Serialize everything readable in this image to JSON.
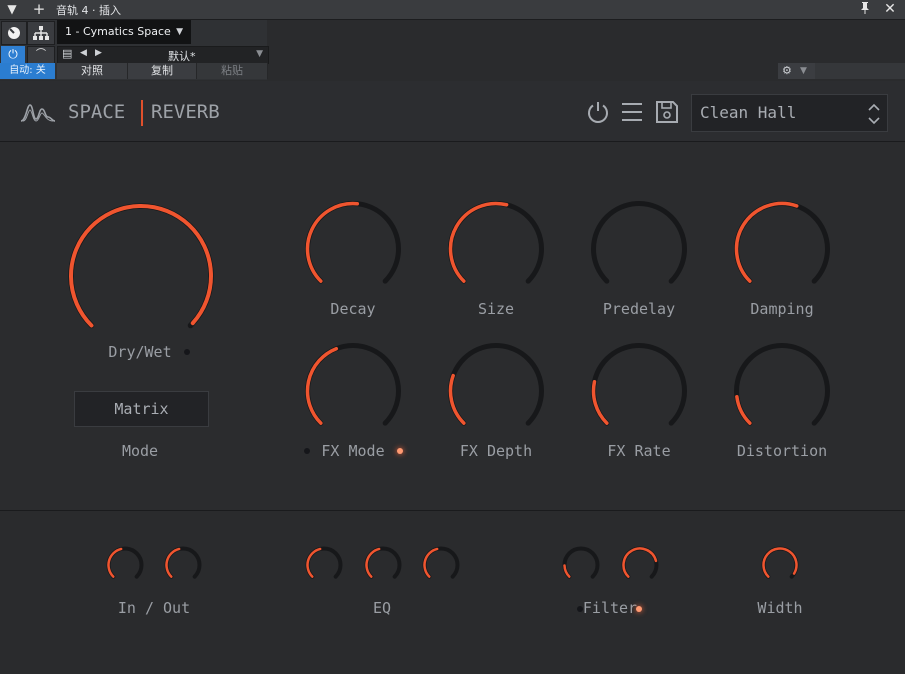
{
  "host": {
    "window_title": "音轨 4 · 插入",
    "plugin_instance": "1 - Cymatics Space",
    "preset_name": "默认*",
    "auto_label": "自动: 关",
    "compare_label": "对照",
    "copy_label": "复制",
    "paste_label": "粘贴"
  },
  "plugin": {
    "brand_left": "SPACE",
    "brand_right": "REVERB",
    "preset": "Clean Hall",
    "accent": "#f0552f",
    "track": "#17181a",
    "dry_wet": {
      "label": "Dry/Wet",
      "value": 0.99
    },
    "mode": {
      "label": "Mode",
      "value": "Matrix"
    },
    "knobs_top": [
      {
        "label": "Decay",
        "value": 0.52
      },
      {
        "label": "Size",
        "value": 0.55
      },
      {
        "label": "Predelay",
        "value": 0.0
      },
      {
        "label": "Damping",
        "value": 0.57
      }
    ],
    "knobs_mid": [
      {
        "label": "FX Mode",
        "value": 0.42
      },
      {
        "label": "FX Depth",
        "value": 0.24
      },
      {
        "label": "FX Rate",
        "value": 0.21
      },
      {
        "label": "Distortion",
        "value": 0.14
      }
    ],
    "groups": [
      {
        "label": "In / Out",
        "knobs": [
          0.45,
          0.45
        ]
      },
      {
        "label": "EQ",
        "knobs": [
          0.45,
          0.45,
          0.45
        ]
      },
      {
        "label": "Filter",
        "knobs": [
          0.16,
          0.78
        ]
      },
      {
        "label": "Width",
        "knobs": [
          0.95
        ]
      }
    ]
  }
}
